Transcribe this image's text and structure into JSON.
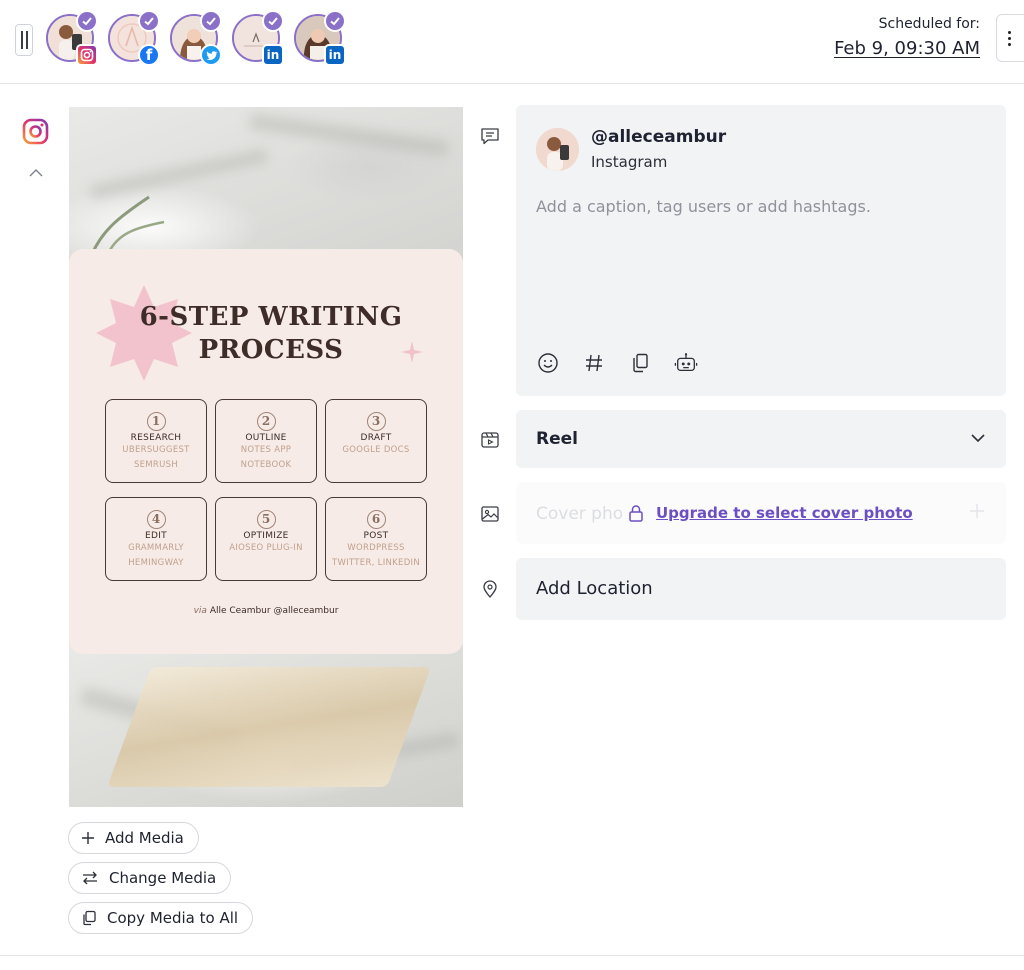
{
  "header": {
    "scheduled_label": "Scheduled for:",
    "scheduled_date": "Feb 9, 09:30 AM",
    "accounts": [
      {
        "network": "instagram",
        "badge": "",
        "selected": true
      },
      {
        "network": "facebook",
        "badge": "f",
        "selected": true
      },
      {
        "network": "twitter",
        "badge": "",
        "selected": true
      },
      {
        "network": "linkedin",
        "badge": "in",
        "selected": true
      },
      {
        "network": "linkedin",
        "badge": "in",
        "selected": true
      }
    ]
  },
  "media": {
    "card_title_line1": "6-STEP WRITING",
    "card_title_line2": "PROCESS",
    "steps": [
      {
        "num": "1",
        "name": "RESEARCH",
        "tools": [
          "UBERSUGGEST",
          "SEMRUSH"
        ]
      },
      {
        "num": "2",
        "name": "OUTLINE",
        "tools": [
          "NOTES APP",
          "NOTEBOOK"
        ]
      },
      {
        "num": "3",
        "name": "DRAFT",
        "tools": [
          "GOOGLE DOCS"
        ]
      },
      {
        "num": "4",
        "name": "EDIT",
        "tools": [
          "GRAMMARLY",
          "HEMINGWAY"
        ]
      },
      {
        "num": "5",
        "name": "OPTIMIZE",
        "tools": [
          "AIOSEO PLUG-IN"
        ]
      },
      {
        "num": "6",
        "name": "POST",
        "tools": [
          "WORDPRESS",
          "TWITTER, LINKEDIN"
        ]
      }
    ],
    "credit_via": "via",
    "credit_text": "Alle Ceambur @alleceambur",
    "buttons": {
      "add": "Add Media",
      "change": "Change Media",
      "copy": "Copy Media to All"
    }
  },
  "caption": {
    "handle": "@alleceambur",
    "network": "Instagram",
    "placeholder": "Add a caption, tag users or add hashtags.",
    "value": ""
  },
  "post_type": {
    "selected": "Reel"
  },
  "cover": {
    "label": "Cover photo",
    "upgrade_link": "Upgrade to select cover photo"
  },
  "location": {
    "label": "Add Location"
  },
  "colors": {
    "accent": "#8a70c9",
    "link": "#6c4fc2",
    "field_bg": "#f2f3f5"
  }
}
